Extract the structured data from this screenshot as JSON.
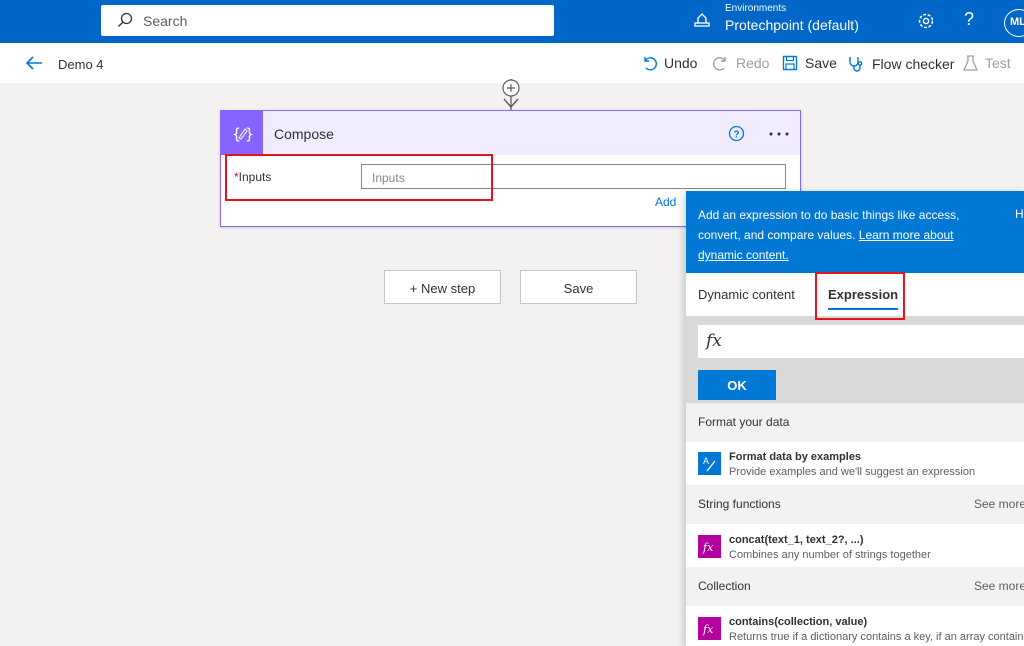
{
  "topbar": {
    "search_label": "Search",
    "env_caption": "Environments",
    "env_name": "Protechpoint (default)",
    "help": "?",
    "avatar": "ML"
  },
  "cmdbar": {
    "flow_name": "Demo 4",
    "undo": "Undo",
    "redo": "Redo",
    "save": "Save",
    "flow_checker": "Flow checker",
    "test": "Test"
  },
  "card": {
    "title": "Compose",
    "inputs_label": "Inputs",
    "inputs_required": "*",
    "inputs_placeholder": "Inputs",
    "add_link": "Add"
  },
  "buttons": {
    "new_step": "+ New step",
    "save": "Save"
  },
  "panel": {
    "desc_text": "Add an expression to do basic things like access, convert, and compare values.",
    "desc_link": "Learn more about dynamic content.",
    "side_letter": "H",
    "tabs": [
      "Dynamic content",
      "Expression"
    ],
    "fx_symbol": "fx",
    "ok": "OK",
    "sections": [
      {
        "title": "Format your data",
        "more": ""
      },
      {
        "title": "String functions",
        "more": "See more"
      },
      {
        "title": "Collection",
        "more": "See more"
      }
    ],
    "items": [
      {
        "name": "Format data by examples",
        "desc": "Provide examples and we'll suggest an expression"
      },
      {
        "name": "concat(text_1, text_2?, ...)",
        "desc": "Combines any number of strings together"
      },
      {
        "name": "contains(collection, value)",
        "desc": "Returns true if a dictionary contains a key, if an array contains"
      }
    ]
  },
  "colors": {
    "header_blue": "#0066c8",
    "accent_blue": "#0078d4",
    "compose_purple": "#8764ff",
    "fx_magenta": "#b4009e",
    "highlight_red": "#e5141b"
  }
}
